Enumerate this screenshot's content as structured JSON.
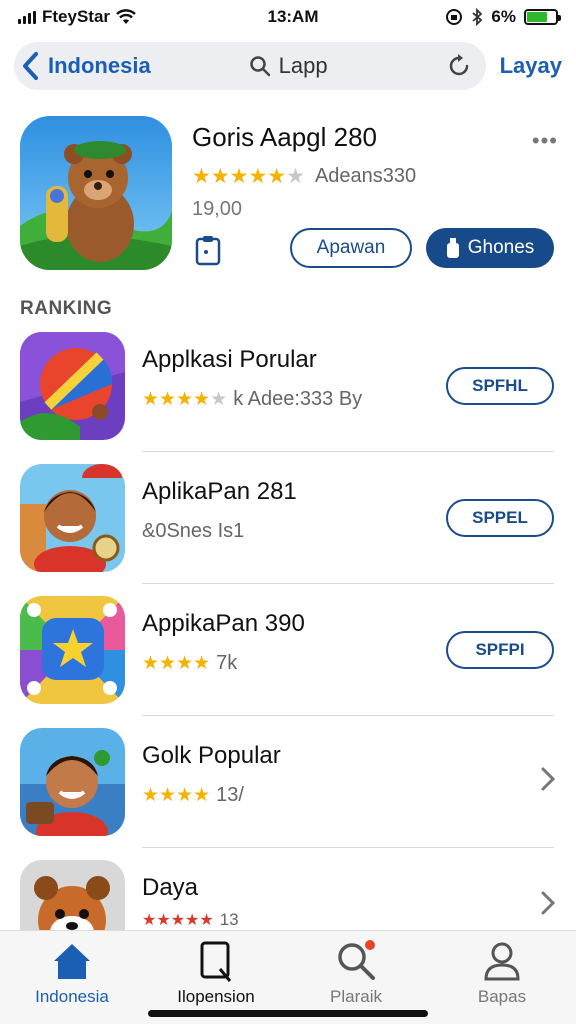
{
  "status_bar": {
    "carrier": "FteyStar",
    "time": "13:AM",
    "battery": "6%",
    "colors": {
      "battery_fill": "#2eb82e"
    }
  },
  "nav": {
    "back_label": "Indonesia",
    "search_text": "Lapp",
    "action_label": "Layay"
  },
  "featured": {
    "title": "Goris Aapgl 280",
    "rating_stars": 4,
    "rating_label": "Adeans330",
    "price": "19,00",
    "secondary_button": "Apawan",
    "primary_button": "Ghones"
  },
  "section_title": "RANKING",
  "apps": [
    {
      "title": "Applkasi Porular",
      "stars": "★★★★",
      "stars_off": "★",
      "meta": "k Adee:333 By",
      "action": "SPFHL"
    },
    {
      "title": "AplikaPan 281",
      "stars": "",
      "stars_off": "",
      "meta": "&0Snes Is1",
      "action": "SPPEL"
    },
    {
      "title": "AppikaPan 390",
      "stars": "★★★★",
      "stars_off": "",
      "meta": "7k",
      "action": "SPFPI"
    },
    {
      "title": "Golk Popular",
      "stars": "★★★★",
      "stars_off": "",
      "meta": "13/",
      "action": ""
    },
    {
      "title": "Daya",
      "stars": "★★★★★",
      "stars_off": "",
      "meta": "13",
      "action": ""
    }
  ],
  "tabs": [
    {
      "label": "Indonesia",
      "icon": "home-icon"
    },
    {
      "label": "Ilopension",
      "icon": "book-icon"
    },
    {
      "label": "Plaraik",
      "icon": "search-icon"
    },
    {
      "label": "Bapas",
      "icon": "person-icon"
    }
  ],
  "colors": {
    "accent": "#1a5fb4",
    "button_dark": "#164a8a",
    "star": "#f5b301"
  }
}
